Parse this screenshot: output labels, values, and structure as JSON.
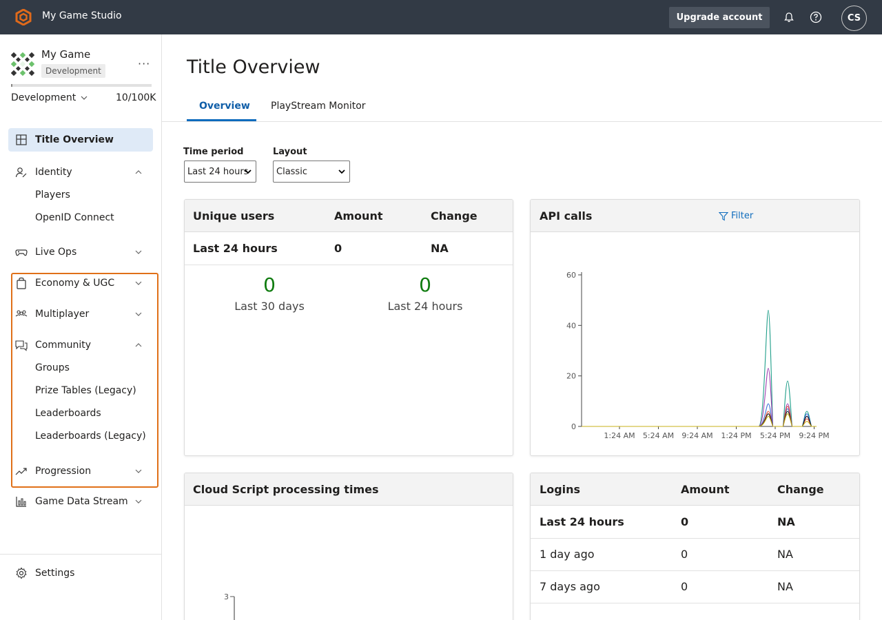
{
  "topbar": {
    "studio_name": "My Game Studio",
    "upgrade_label": "Upgrade account",
    "avatar_initials": "CS",
    "icons": [
      "studio-logo-icon",
      "bell-icon",
      "help-icon"
    ],
    "accent_color": "#e06a1b"
  },
  "sidebar": {
    "game_name": "My Game",
    "env_badge": "Development",
    "more_label": "···",
    "environment": "Development",
    "usage": "10/100K",
    "usage_fraction": 0.0001,
    "items": [
      {
        "label": "Title Overview",
        "icon": "grid-icon",
        "active": true
      },
      {
        "label": "Identity",
        "icon": "identity-icon",
        "expanded": true,
        "children": [
          "Players",
          "OpenID Connect"
        ]
      },
      {
        "label": "Live Ops",
        "icon": "gamepad-icon",
        "expanded": false
      },
      {
        "label": "Economy & UGC",
        "icon": "shopping-bag-icon",
        "expanded": false
      },
      {
        "label": "Multiplayer",
        "icon": "people-icon",
        "expanded": false
      },
      {
        "label": "Community",
        "icon": "chat-icon",
        "expanded": true,
        "children": [
          "Groups",
          "Prize Tables (Legacy)",
          "Leaderboards",
          "Leaderboards (Legacy)"
        ]
      },
      {
        "label": "Progression",
        "icon": "trending-icon",
        "expanded": false
      },
      {
        "label": "Game Data Stream",
        "icon": "bar-chart-icon",
        "expanded": false
      }
    ],
    "settings_label": "Settings",
    "highlight_color": "#e07018"
  },
  "main": {
    "title": "Title Overview",
    "tabs": [
      {
        "label": "Overview",
        "active": true
      },
      {
        "label": "PlayStream Monitor",
        "active": false
      }
    ],
    "time_period": {
      "label": "Time period",
      "value": "Last 24 hours"
    },
    "layout": {
      "label": "Layout",
      "value": "Classic"
    }
  },
  "unique_users": {
    "headers": [
      "Unique users",
      "Amount",
      "Change"
    ],
    "row": [
      "Last 24 hours",
      "0",
      "NA"
    ],
    "stats": [
      {
        "value": "0",
        "caption": "Last 30 days"
      },
      {
        "value": "0",
        "caption": "Last 24 hours"
      }
    ]
  },
  "api_calls": {
    "title": "API calls",
    "filter_label": "Filter"
  },
  "cloud_script": {
    "title": "Cloud Script processing times",
    "y_tick": "3"
  },
  "logins": {
    "headers": [
      "Logins",
      "Amount",
      "Change"
    ],
    "rows": [
      {
        "period": "Last 24 hours",
        "amount": "0",
        "change": "NA",
        "bold": true
      },
      {
        "period": "1 day ago",
        "amount": "0",
        "change": "NA",
        "bold": false
      },
      {
        "period": "7 days ago",
        "amount": "0",
        "change": "NA",
        "bold": false
      }
    ]
  },
  "chart_data": {
    "type": "line",
    "yticks": [
      "0",
      "20",
      "40",
      "60"
    ],
    "xticks": [
      "1:24 AM",
      "5:24 AM",
      "9:24 AM",
      "1:24 PM",
      "5:24 PM",
      "9:24 PM"
    ],
    "ylim": [
      0,
      60
    ],
    "x": [
      "5:24 PM",
      "6:24 PM",
      "7:24 PM",
      "8:24 PM",
      "9:24 PM"
    ],
    "series": [
      {
        "color": "#1f9e89",
        "values": [
          46,
          0,
          18,
          0,
          6
        ]
      },
      {
        "color": "#9e3fb0",
        "values": [
          23,
          0,
          9,
          0,
          4
        ]
      },
      {
        "color": "#3a6fd8",
        "values": [
          9,
          0,
          7,
          0,
          5
        ]
      },
      {
        "color": "#e0523b",
        "values": [
          6,
          0,
          8,
          0,
          3
        ]
      },
      {
        "color": "#1a1a1a",
        "values": [
          5,
          0,
          6,
          0,
          4
        ]
      },
      {
        "color": "#c7b01a",
        "values": [
          4,
          0,
          5,
          0,
          2
        ]
      }
    ]
  }
}
